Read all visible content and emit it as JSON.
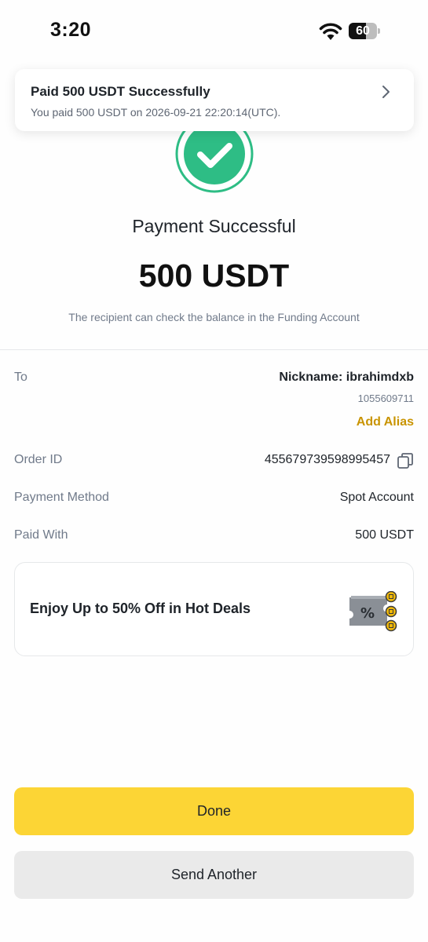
{
  "status_bar": {
    "time": "3:20",
    "battery_level": "60",
    "battery_fraction": 0.6,
    "icons": [
      "wifi-icon",
      "battery-icon"
    ]
  },
  "toast": {
    "title": "Paid 500 USDT Successfully",
    "message": "You paid 500 USDT on 2026-09-21 22:20:14(UTC).",
    "icon": "chevron-right-icon"
  },
  "payment": {
    "icon": "checkmark-circle-icon",
    "title": "Payment Successful",
    "amount": "500 USDT",
    "note": "The recipient can check the balance in the Funding Account"
  },
  "details": {
    "to_label": "To",
    "to_nickname": "Nickname: ibrahimdxb",
    "to_id": "1055609711",
    "add_alias": "Add Alias",
    "order_id_label": "Order ID",
    "order_id": "455679739598995457",
    "payment_method_label": "Payment Method",
    "payment_method": "Spot Account",
    "paid_with_label": "Paid With",
    "paid_with": "500 USDT"
  },
  "promo": {
    "text": "Enjoy Up to 50% Off in Hot Deals",
    "icon": "discount-coupon-icon"
  },
  "buttons": {
    "done": "Done",
    "send_another": "Send Another"
  },
  "colors": {
    "accent_yellow": "#fcd535",
    "success_green": "#2ebd85",
    "link_gold": "#c99400",
    "secondary_button": "#eaeaea"
  }
}
